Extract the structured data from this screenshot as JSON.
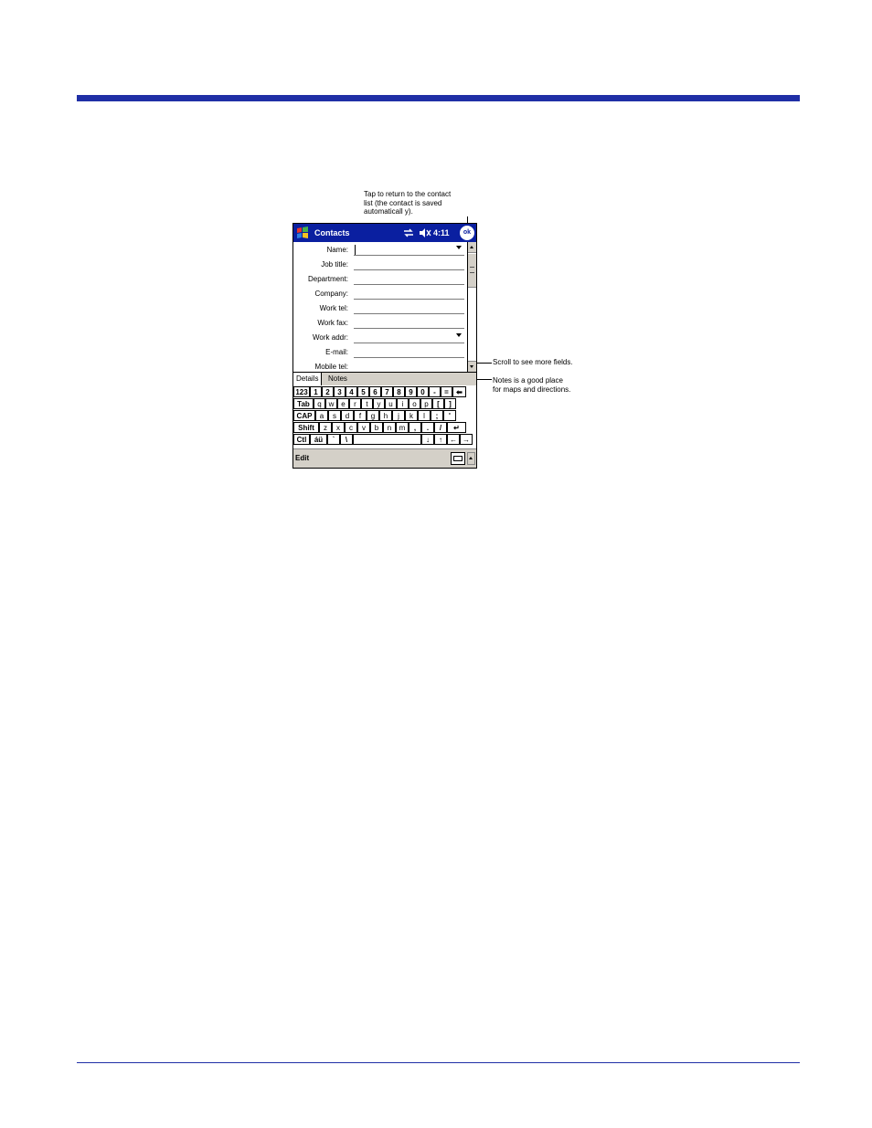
{
  "callouts": {
    "ok": "Tap to return to the contact\nlist (the contact is saved\nautomaticall y).",
    "scroll": "Scroll to see more fields.",
    "notes": "Notes is a good place\nfor maps and directions."
  },
  "titlebar": {
    "app": "Contacts",
    "time": "4:11",
    "ok_label": "ok"
  },
  "fields": [
    {
      "label": "Name:",
      "dropdown": true
    },
    {
      "label": "Job title:",
      "dropdown": false
    },
    {
      "label": "Department:",
      "dropdown": false
    },
    {
      "label": "Company:",
      "dropdown": false
    },
    {
      "label": "Work tel:",
      "dropdown": false
    },
    {
      "label": "Work fax:",
      "dropdown": false
    },
    {
      "label": "Work addr:",
      "dropdown": true
    },
    {
      "label": "E-mail:",
      "dropdown": false
    },
    {
      "label": "Mobile tel:",
      "dropdown": false
    }
  ],
  "tabs": {
    "details": "Details",
    "notes": "Notes"
  },
  "keyboard": {
    "row1": [
      "123",
      "1",
      "2",
      "3",
      "4",
      "5",
      "6",
      "7",
      "8",
      "9",
      "0",
      "-",
      "=",
      "⬅"
    ],
    "row2": [
      "Tab",
      "q",
      "w",
      "e",
      "r",
      "t",
      "y",
      "u",
      "i",
      "o",
      "p",
      "[",
      "]"
    ],
    "row3": [
      "CAP",
      "a",
      "s",
      "d",
      "f",
      "g",
      "h",
      "j",
      "k",
      "l",
      ";",
      "'"
    ],
    "row4": [
      "Shift",
      "z",
      "x",
      "c",
      "v",
      "b",
      "n",
      "m",
      ",",
      ".",
      "/",
      "↵"
    ],
    "row5": [
      "Ctl",
      "áü",
      "`",
      "\\",
      "",
      "↓",
      "↑",
      "←",
      "→"
    ]
  },
  "menubar": {
    "edit": "Edit"
  },
  "colors": {
    "accent": "#1f2fa6",
    "titlebar": "#0a1fa0"
  }
}
